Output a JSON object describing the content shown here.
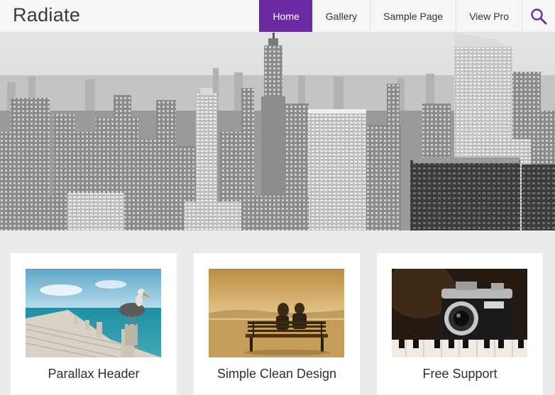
{
  "header": {
    "logo": "Radiate",
    "nav": [
      {
        "label": "Home",
        "active": true
      },
      {
        "label": "Gallery",
        "active": false
      },
      {
        "label": "Sample Page",
        "active": false
      },
      {
        "label": "View Pro",
        "active": false
      }
    ],
    "search_icon": "search-icon"
  },
  "colors": {
    "accent": "#6b2aa3",
    "header_bg": "#f6f6f6",
    "page_bg": "#ebebeb"
  },
  "features": [
    {
      "title": "Parallax Header",
      "image": "pelican-on-pier-photo"
    },
    {
      "title": "Simple Clean Design",
      "image": "couple-on-bench-photo"
    },
    {
      "title": "Free Support",
      "image": "vintage-camera-photo"
    }
  ]
}
